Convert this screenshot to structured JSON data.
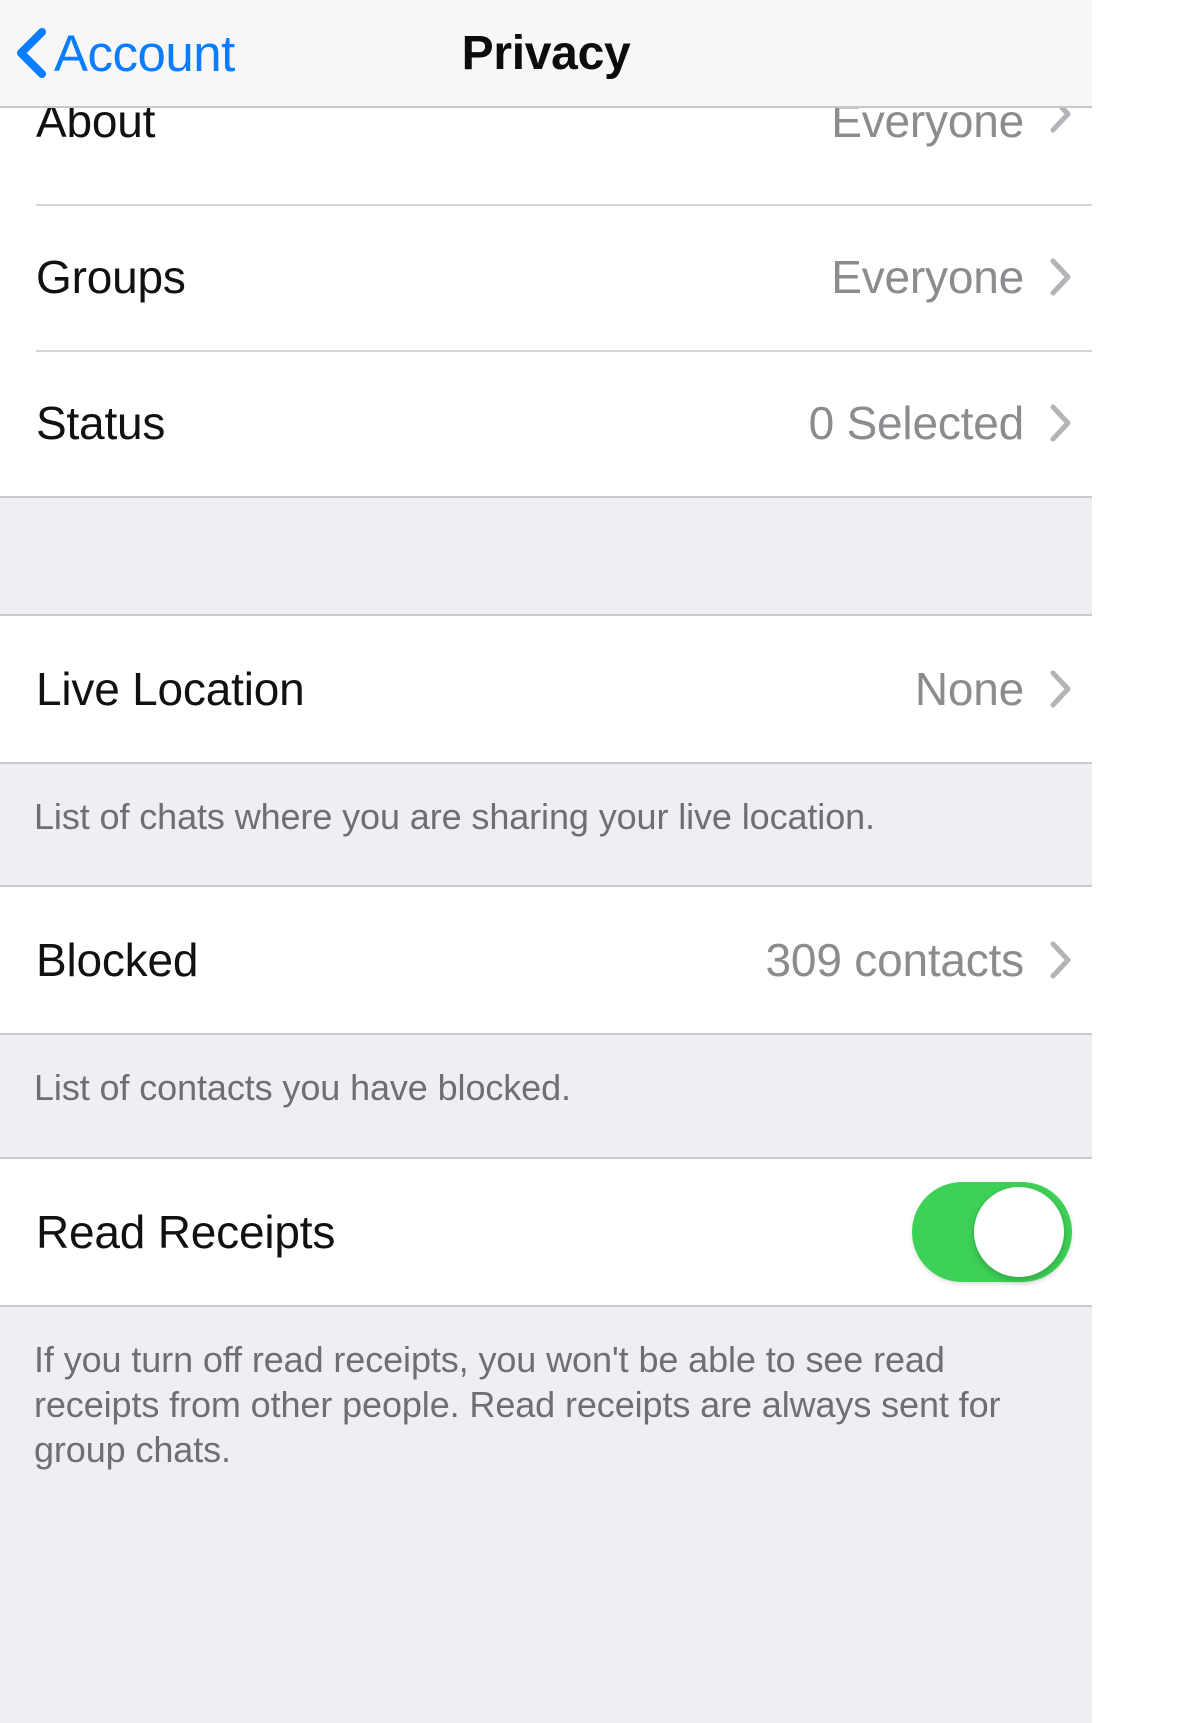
{
  "navbar": {
    "back_label": "Account",
    "back_icon": "chevron-left-icon",
    "title": "Privacy"
  },
  "colors": {
    "accent_blue": "#0a7cff",
    "toggle_on_green": "#3ed157",
    "value_gray": "#8b8b90",
    "footer_gray": "#6e6e73",
    "group_background": "#eeeef3",
    "row_background": "#ffffff"
  },
  "sections": [
    {
      "name": "visibility-section",
      "rows": [
        {
          "label": "About",
          "value": "Everyone",
          "accessory": "chevron-right-icon"
        },
        {
          "label": "Groups",
          "value": "Everyone",
          "accessory": "chevron-right-icon"
        },
        {
          "label": "Status",
          "value": "0 Selected",
          "accessory": "chevron-right-icon"
        }
      ]
    },
    {
      "name": "live-location-section",
      "rows": [
        {
          "label": "Live Location",
          "value": "None",
          "accessory": "chevron-right-icon"
        }
      ],
      "footer": "List of chats where you are sharing your live location."
    },
    {
      "name": "blocked-section",
      "rows": [
        {
          "label": "Blocked",
          "value": "309 contacts",
          "accessory": "chevron-right-icon"
        }
      ],
      "footer": "List of contacts you have blocked."
    },
    {
      "name": "read-receipts-section",
      "rows": [
        {
          "label": "Read Receipts",
          "value": "",
          "accessory": "toggle",
          "toggle_state": "on"
        }
      ],
      "footer": "If you turn off read receipts, you won't be able to see read receipts from other people. Read receipts are always sent for group chats."
    }
  ]
}
